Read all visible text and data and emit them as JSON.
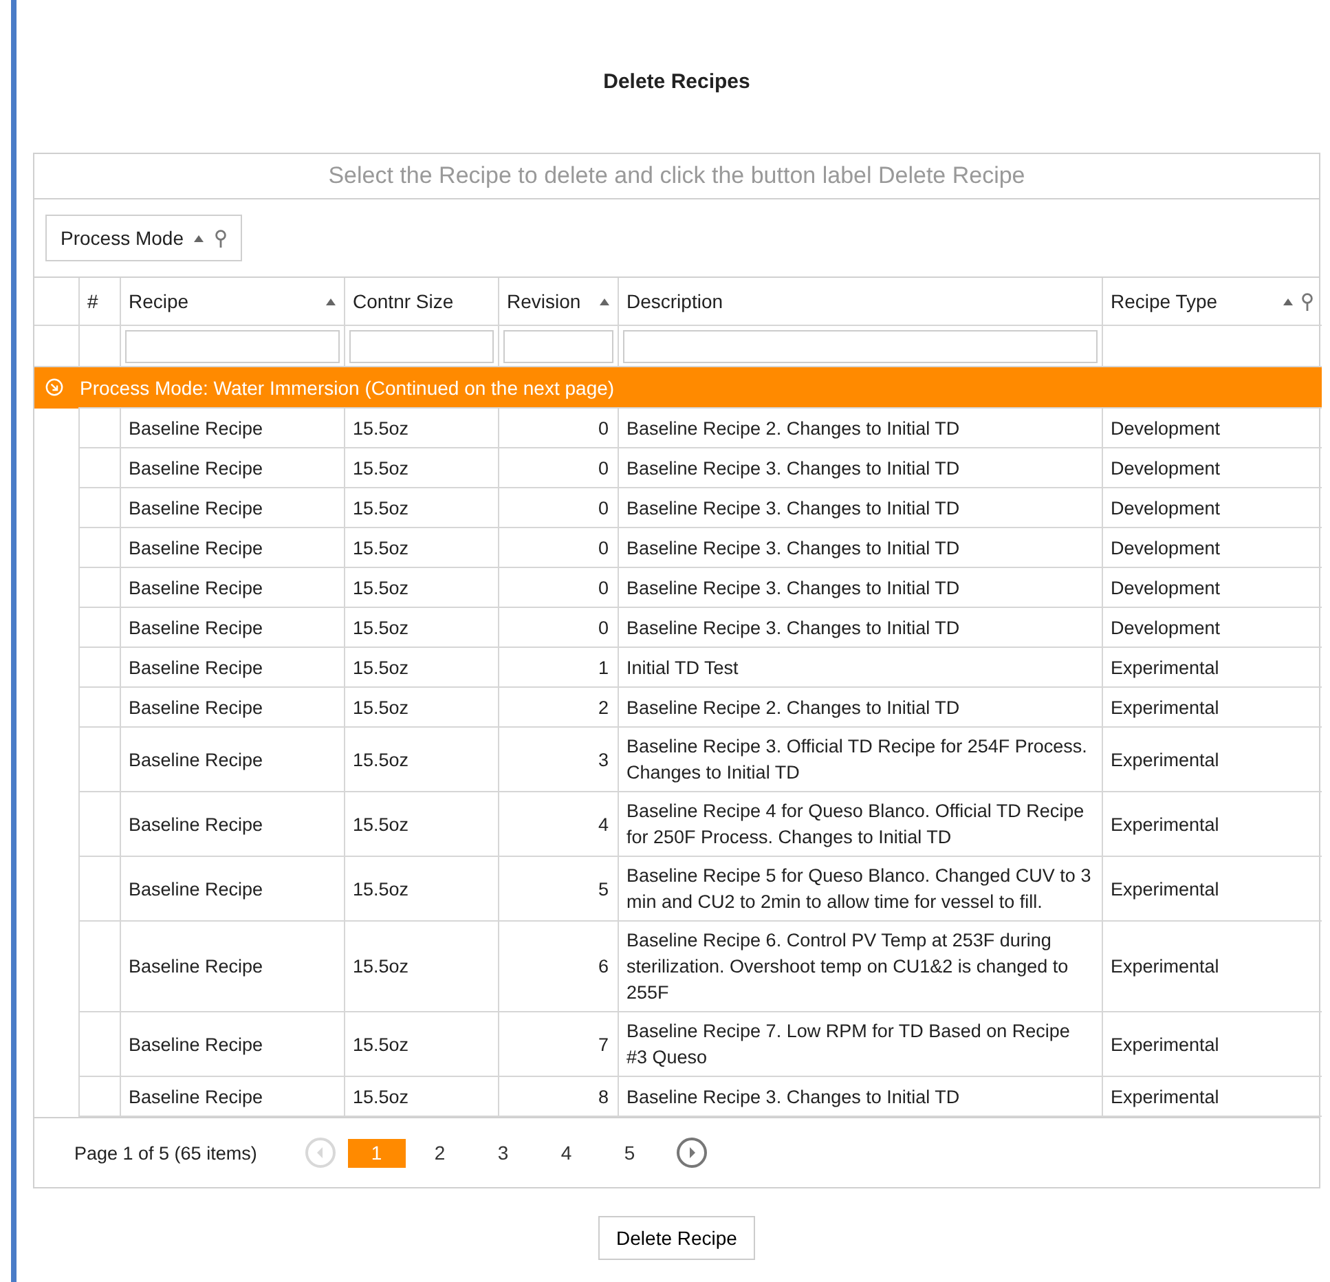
{
  "title": "Delete Recipes",
  "grid": {
    "caption": "Select the Recipe to delete and click the button label Delete Recipe",
    "group_panel": [
      {
        "label": "Process Mode",
        "sorted": true,
        "filter": true
      }
    ],
    "columns": [
      {
        "label": "#",
        "sorted": false,
        "filter": false
      },
      {
        "label": "Recipe",
        "sorted": true,
        "filter": false
      },
      {
        "label": "Contnr Size",
        "sorted": false,
        "filter": false
      },
      {
        "label": "Revision",
        "sorted": true,
        "filter": false
      },
      {
        "label": "Description",
        "sorted": false,
        "filter": false
      },
      {
        "label": "Recipe Type",
        "sorted": true,
        "filter": true
      }
    ],
    "group_row": {
      "label": "Process Mode: Water Immersion (Continued on the next page)",
      "expanded": true
    },
    "rows": [
      {
        "recipe": "Baseline Recipe",
        "size": "15.5oz",
        "revision": "0",
        "description": "Baseline Recipe 2. Changes to Initial TD",
        "type": "Development"
      },
      {
        "recipe": "Baseline Recipe",
        "size": "15.5oz",
        "revision": "0",
        "description": "Baseline Recipe 3. Changes to Initial TD",
        "type": "Development"
      },
      {
        "recipe": "Baseline Recipe",
        "size": "15.5oz",
        "revision": "0",
        "description": "Baseline Recipe 3. Changes to Initial TD",
        "type": "Development"
      },
      {
        "recipe": "Baseline Recipe",
        "size": "15.5oz",
        "revision": "0",
        "description": "Baseline Recipe 3. Changes to Initial TD",
        "type": "Development"
      },
      {
        "recipe": "Baseline Recipe",
        "size": "15.5oz",
        "revision": "0",
        "description": "Baseline Recipe 3. Changes to Initial TD",
        "type": "Development"
      },
      {
        "recipe": "Baseline Recipe",
        "size": "15.5oz",
        "revision": "0",
        "description": "Baseline Recipe 3. Changes to Initial TD",
        "type": "Development"
      },
      {
        "recipe": "Baseline Recipe",
        "size": "15.5oz",
        "revision": "1",
        "description": "Initial TD Test",
        "type": "Experimental"
      },
      {
        "recipe": "Baseline Recipe",
        "size": "15.5oz",
        "revision": "2",
        "description": "Baseline Recipe 2. Changes to Initial TD",
        "type": "Experimental"
      },
      {
        "recipe": "Baseline Recipe",
        "size": "15.5oz",
        "revision": "3",
        "description": "Baseline Recipe 3. Official TD Recipe for 254F Process. Changes to Initial TD",
        "type": "Experimental"
      },
      {
        "recipe": "Baseline Recipe",
        "size": "15.5oz",
        "revision": "4",
        "description": "Baseline Recipe 4 for Queso Blanco. Official TD Recipe for 250F Process. Changes to Initial TD",
        "type": "Experimental"
      },
      {
        "recipe": "Baseline Recipe",
        "size": "15.5oz",
        "revision": "5",
        "description": "Baseline Recipe 5 for Queso Blanco. Changed CUV to 3 min and CU2 to 2min to allow time for vessel to fill.",
        "type": "Experimental"
      },
      {
        "recipe": "Baseline Recipe",
        "size": "15.5oz",
        "revision": "6",
        "description": "Baseline Recipe 6. Control PV Temp at 253F during sterilization. Overshoot temp on CU1&2 is changed to 255F",
        "type": "Experimental"
      },
      {
        "recipe": "Baseline Recipe",
        "size": "15.5oz",
        "revision": "7",
        "description": "Baseline Recipe 7. Low RPM for TD Based on Recipe #3 Queso",
        "type": "Experimental"
      },
      {
        "recipe": "Baseline Recipe",
        "size": "15.5oz",
        "revision": "8",
        "description": "Baseline Recipe 3. Changes to Initial TD",
        "type": "Experimental"
      }
    ],
    "pager": {
      "summary": "Page 1 of 5 (65 items)",
      "prev_disabled": true,
      "next_disabled": false,
      "pages": [
        {
          "label": "1",
          "selected": true
        },
        {
          "label": "2",
          "selected": false
        },
        {
          "label": "3",
          "selected": false
        },
        {
          "label": "4",
          "selected": false
        },
        {
          "label": "5",
          "selected": false
        }
      ]
    }
  },
  "button": "Delete Recipe"
}
